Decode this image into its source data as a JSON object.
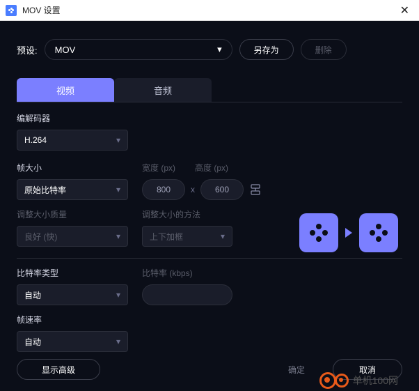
{
  "titlebar": {
    "title": "MOV 设置"
  },
  "preset": {
    "label": "预设:",
    "value": "MOV",
    "save_as": "另存为",
    "delete": "删除"
  },
  "tabs": {
    "video": "视频",
    "audio": "音频"
  },
  "codec": {
    "label": "编解码器",
    "value": "H.264"
  },
  "frame_size": {
    "label": "帧大小",
    "value": "原始比特率",
    "width_label": "宽度 (px)",
    "height_label": "高度 (px)",
    "width": "800",
    "height": "600"
  },
  "resize_quality": {
    "label": "调整大小质量",
    "value": "良好 (快)"
  },
  "resize_method": {
    "label": "调整大小的方法",
    "value": "上下加框"
  },
  "bitrate_type": {
    "label": "比特率类型",
    "value": "自动"
  },
  "bitrate": {
    "label": "比特率 (kbps)",
    "value": ""
  },
  "framerate": {
    "label": "帧速率",
    "value": "自动"
  },
  "footer": {
    "advanced": "显示高级",
    "ok": "确定",
    "cancel": "取消"
  },
  "watermark": "单机100网"
}
